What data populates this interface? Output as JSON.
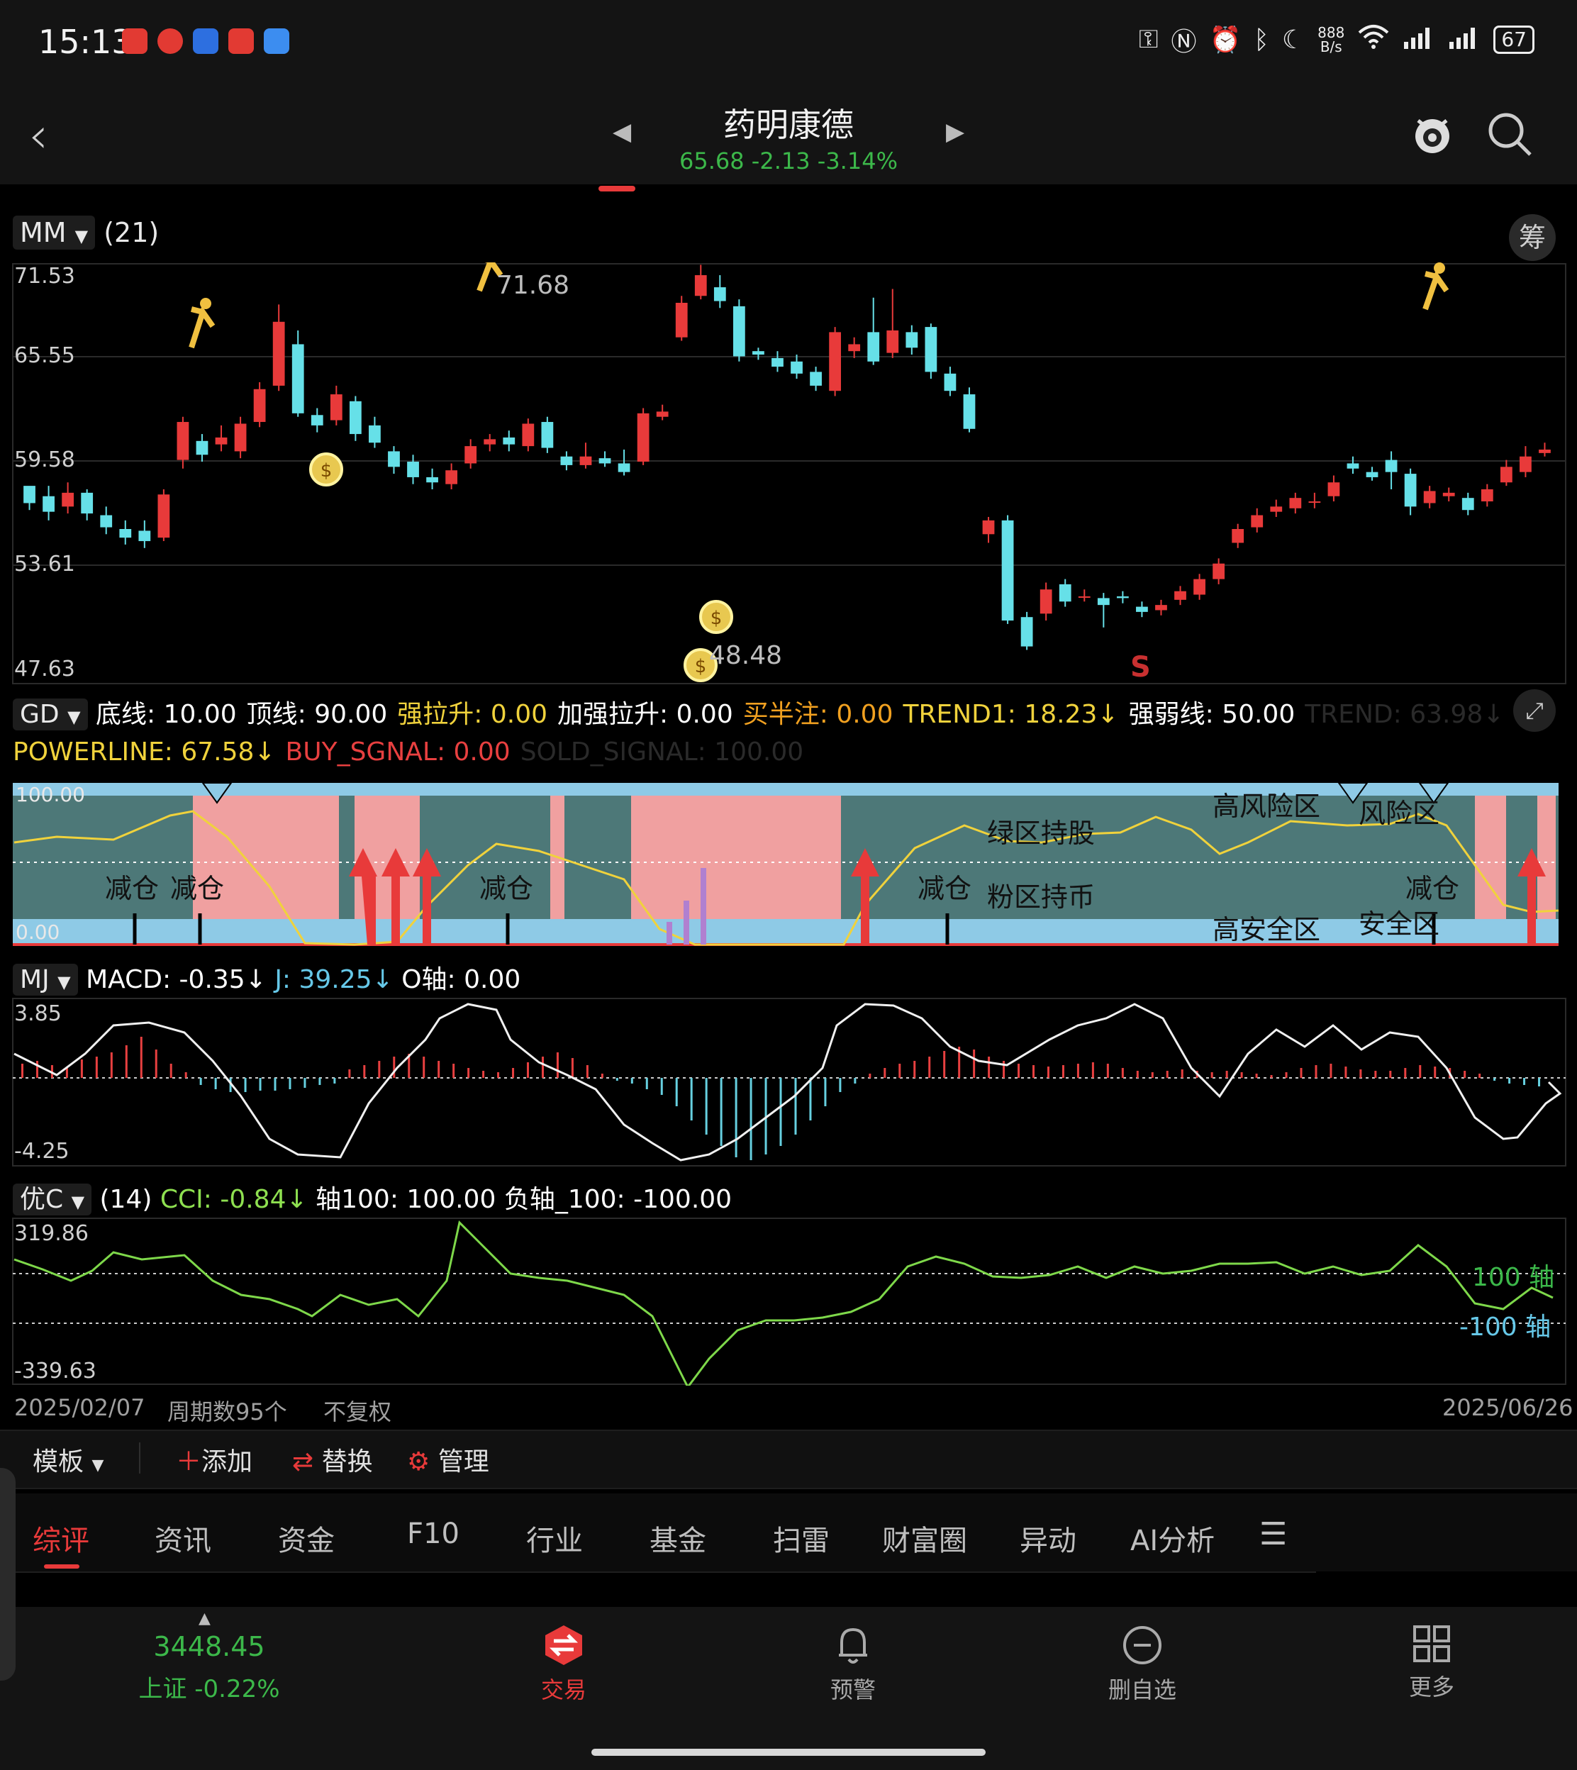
{
  "status": {
    "time": "15:13",
    "net_speed_top": "888",
    "net_speed_bottom": "B/s",
    "battery": "67"
  },
  "header": {
    "title": "药明康德",
    "quote": "65.68 -2.13 -3.14%"
  },
  "main_panel": {
    "indicator": "MM",
    "param": "(21)",
    "chip_button": "筹",
    "y_ticks": [
      "71.53",
      "65.55",
      "59.58",
      "53.61",
      "47.63"
    ],
    "high_label": "71.68",
    "low_label": "48.48",
    "signal": "S"
  },
  "gd_panel": {
    "indicator": "GD",
    "line1": [
      {
        "t": "底线: 10.00",
        "c": "#ffffff"
      },
      {
        "t": "顶线: 90.00",
        "c": "#ffffff"
      },
      {
        "t": "强拉升: 0.00",
        "c": "#f0d23c"
      },
      {
        "t": "加强拉升: 0.00",
        "c": "#ffffff"
      },
      {
        "t": "买半注: 0.00",
        "c": "#f0a020"
      },
      {
        "t": "TREND1: 18.23↓",
        "c": "#f0d23c"
      },
      {
        "t": "强弱线: 50.00",
        "c": "#ffffff"
      },
      {
        "t": "TREND: 63.98↓",
        "c": "#2a2a2a"
      }
    ],
    "line2": [
      {
        "t": "POWERLINE: 67.58↓",
        "c": "#f0d23c"
      },
      {
        "t": "BUY_SGNAL: 0.00",
        "c": "#e84040"
      },
      {
        "t": "SOLD_SIGNAL: 100.00",
        "c": "#2a2a2a"
      }
    ],
    "top_val": "100.00",
    "bottom_val": "0.00",
    "labels": [
      "减仓",
      "减仓",
      "减仓",
      "减仓",
      "绿区持股",
      "粉区持币",
      "高风险区",
      "风险区",
      "高安全区",
      "安全区",
      "减仓"
    ]
  },
  "mj_panel": {
    "indicator": "MJ",
    "macd": "MACD: -0.35↓",
    "j": "J: 39.25↓",
    "o": "O轴: 0.00",
    "top_val": "3.85",
    "bottom_val": "-4.25"
  },
  "cci_panel": {
    "indicator": "优C",
    "param": "(14)",
    "cci": "CCI: -0.84↓",
    "axis100": "轴100: 100.00",
    "neg_axis": "负轴_100: -100.00",
    "top_val": "319.86",
    "bottom_val": "-339.63",
    "pos_label": "100 轴",
    "neg_label": "-100 轴"
  },
  "footer_axis": {
    "start_date": "2025/02/07",
    "periods": "周期数95个",
    "adjust": "不复权",
    "end_date": "2025/06/26"
  },
  "toolbar": {
    "template": "模板",
    "add": "添加",
    "replace": "替换",
    "manage": "管理"
  },
  "tabs": [
    "综评",
    "资讯",
    "资金",
    "F10",
    "行业",
    "基金",
    "扫雷",
    "财富圈",
    "异动",
    "AI分析"
  ],
  "bottom": {
    "index_value": "3448.45",
    "index_name": "上证 -0.22%",
    "trade": "交易",
    "alert": "预警",
    "remove": "删自选",
    "more": "更多"
  },
  "colors": {
    "up": "#e83a3a",
    "down": "#66e0e8",
    "green": "#3cb84a"
  },
  "chart_data": {
    "type": "candlestick",
    "ylim": [
      47.63,
      71.53
    ],
    "candles": [
      [
        59,
        58,
        58.5,
        57.6
      ],
      [
        58.4,
        57.5,
        59,
        57
      ],
      [
        57.8,
        58.6,
        59.2,
        57.4
      ],
      [
        58.6,
        57.4,
        58.8,
        57
      ],
      [
        57.3,
        56.6,
        57.8,
        56.2
      ],
      [
        56.5,
        56,
        57,
        55.6
      ],
      [
        56.4,
        55.8,
        57,
        55.4
      ],
      [
        56,
        58.5,
        58.8,
        55.8
      ],
      [
        60.5,
        62.7,
        63,
        60
      ],
      [
        61.6,
        60.8,
        62,
        60.4
      ],
      [
        61.4,
        61.8,
        62.5,
        61
      ],
      [
        61,
        62.6,
        63,
        60.6
      ],
      [
        62.7,
        64.6,
        65,
        62.4
      ],
      [
        64.8,
        68.5,
        69.5,
        64.5
      ],
      [
        67.2,
        63.2,
        68,
        63
      ],
      [
        63.1,
        62.5,
        63.5,
        62.1
      ],
      [
        62.8,
        64.3,
        64.8,
        62.5
      ],
      [
        63.9,
        62,
        64.2,
        61.6
      ],
      [
        62.5,
        61.5,
        63,
        61.2
      ],
      [
        61,
        60.1,
        61.3,
        59.7
      ],
      [
        60.4,
        59.5,
        60.8,
        59.1
      ],
      [
        59.5,
        59.2,
        60,
        58.8
      ],
      [
        59.1,
        59.9,
        60.3,
        58.8
      ],
      [
        60.3,
        61.3,
        61.7,
        60
      ],
      [
        61.4,
        61.7,
        62,
        61
      ],
      [
        61.8,
        61.4,
        62.2,
        61
      ],
      [
        61.3,
        62.6,
        62.9,
        61
      ],
      [
        62.7,
        61.2,
        63,
        60.9
      ],
      [
        60.7,
        60.2,
        61,
        59.9
      ],
      [
        60.2,
        60.7,
        61.5,
        60
      ],
      [
        60.6,
        60.3,
        61,
        60.1
      ],
      [
        60.3,
        59.8,
        61.1,
        59.6
      ],
      [
        60.4,
        63.2,
        63.5,
        60.2
      ],
      [
        63,
        63.3,
        63.7,
        62.8
      ],
      [
        67.6,
        69.6,
        70,
        67.4
      ],
      [
        70,
        71.2,
        71.8,
        69.8
      ],
      [
        70.5,
        69.7,
        71.2,
        69.3
      ],
      [
        69.4,
        66.5,
        69.8,
        66.2
      ],
      [
        66.8,
        66.6,
        67,
        66.3
      ],
      [
        66.4,
        65.9,
        66.8,
        65.6
      ],
      [
        66.2,
        65.5,
        66.6,
        65.2
      ],
      [
        65.6,
        64.8,
        65.9,
        64.5
      ],
      [
        64.5,
        67.9,
        68.2,
        64.2
      ],
      [
        66.8,
        67.2,
        67.6,
        66.4
      ],
      [
        67.9,
        66.2,
        69.9,
        66
      ],
      [
        66.7,
        68,
        70.4,
        66.4
      ],
      [
        67.9,
        67,
        68.3,
        66.6
      ],
      [
        68.2,
        65.6,
        68.4,
        65.2
      ],
      [
        65.5,
        64.5,
        65.9,
        64.2
      ],
      [
        64.3,
        62.3,
        64.7,
        62.1
      ],
      [
        56.2,
        57,
        57.2,
        55.7
      ],
      [
        57,
        51.2,
        57.3,
        51
      ],
      [
        51.4,
        49.7,
        51.7,
        49.5
      ],
      [
        51.6,
        53,
        53.4,
        51.2
      ],
      [
        53.3,
        52.3,
        53.6,
        52
      ],
      [
        52.6,
        52.6,
        53,
        52.3
      ],
      [
        52.5,
        52.1,
        52.8,
        50.8
      ],
      [
        52.6,
        52.5,
        52.9,
        52.2
      ],
      [
        52,
        51.7,
        52.3,
        51.4
      ],
      [
        51.8,
        52.1,
        52.4,
        51.5
      ],
      [
        52.4,
        52.9,
        53.2,
        52.1
      ],
      [
        52.7,
        53.6,
        53.9,
        52.4
      ],
      [
        53.6,
        54.5,
        54.8,
        53.3
      ],
      [
        55.7,
        56.5,
        56.8,
        55.4
      ],
      [
        56.6,
        57.3,
        57.7,
        56.3
      ],
      [
        57.5,
        57.8,
        58.2,
        57.2
      ],
      [
        57.7,
        58.3,
        58.6,
        57.4
      ],
      [
        58.1,
        58.1,
        58.6,
        57.7
      ],
      [
        58.4,
        59.2,
        59.6,
        58.1
      ],
      [
        60.3,
        60,
        60.7,
        59.7
      ],
      [
        59.8,
        59.5,
        60.1,
        59.3
      ],
      [
        60.5,
        59.8,
        61,
        58.8
      ],
      [
        59.7,
        57.8,
        60,
        57.3
      ],
      [
        58,
        58.7,
        59,
        57.7
      ],
      [
        58.4,
        58.6,
        58.9,
        58.1
      ],
      [
        58.3,
        57.6,
        58.6,
        57.3
      ],
      [
        58.1,
        58.8,
        59.1,
        57.8
      ],
      [
        59.2,
        60.1,
        60.5,
        59
      ],
      [
        59.8,
        60.7,
        61.3,
        59.5
      ],
      [
        60.9,
        61.1,
        61.5,
        60.7
      ]
    ]
  }
}
